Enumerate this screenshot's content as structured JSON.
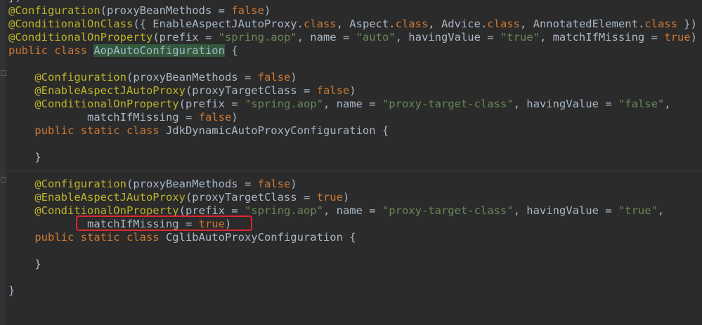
{
  "editor": {
    "language": "java",
    "colors": {
      "background": "#2b2b2b",
      "annotation": "#bbb529",
      "keyword": "#cc7832",
      "string": "#6a8759",
      "plain": "#a9b7c6",
      "identifier_highlight": "#32593d",
      "callout_box": "#e0262f"
    },
    "lines": [
      {
        "t": [
          [
            "pn",
            "})"
          ]
        ]
      },
      {
        "t": [
          [
            "ann",
            "@Configuration"
          ],
          [
            "pn",
            "(proxyBeanMethods = "
          ],
          [
            "kw",
            "false"
          ],
          [
            "pn",
            ")"
          ]
        ]
      },
      {
        "t": [
          [
            "ann",
            "@ConditionalOnClass"
          ],
          [
            "pn",
            "({ EnableAspectJAutoProxy."
          ],
          [
            "kw",
            "class"
          ],
          [
            "pn",
            ", Aspect."
          ],
          [
            "kw",
            "class"
          ],
          [
            "pn",
            ", Advice."
          ],
          [
            "kw",
            "class"
          ],
          [
            "pn",
            ", AnnotatedElement."
          ],
          [
            "kw",
            "class"
          ],
          [
            "pn",
            " })"
          ]
        ]
      },
      {
        "t": [
          [
            "ann",
            "@ConditionalOnProperty"
          ],
          [
            "pn",
            "(prefix = "
          ],
          [
            "str",
            "\"spring.aop\""
          ],
          [
            "pn",
            ", name = "
          ],
          [
            "str",
            "\"auto\""
          ],
          [
            "pn",
            ", havingValue = "
          ],
          [
            "str",
            "\"true\""
          ],
          [
            "pn",
            ", matchIfMissing = "
          ],
          [
            "kw",
            "true"
          ],
          [
            "pn",
            ")"
          ]
        ]
      },
      {
        "t": [
          [
            "kw",
            "public class "
          ],
          [
            "hl",
            "AopAutoConfiguration"
          ],
          [
            "pn",
            " {"
          ]
        ]
      },
      {
        "t": []
      },
      {
        "t": [
          [
            "pn",
            "    "
          ],
          [
            "ann",
            "@Configuration"
          ],
          [
            "pn",
            "(proxyBeanMethods = "
          ],
          [
            "kw",
            "false"
          ],
          [
            "pn",
            ")"
          ]
        ]
      },
      {
        "t": [
          [
            "pn",
            "    "
          ],
          [
            "ann",
            "@EnableAspectJAutoProxy"
          ],
          [
            "pn",
            "(proxyTargetClass = "
          ],
          [
            "kw",
            "false"
          ],
          [
            "pn",
            ")"
          ]
        ]
      },
      {
        "t": [
          [
            "pn",
            "    "
          ],
          [
            "ann",
            "@ConditionalOnProperty"
          ],
          [
            "pn",
            "(prefix = "
          ],
          [
            "str",
            "\"spring.aop\""
          ],
          [
            "pn",
            ", name = "
          ],
          [
            "str",
            "\"proxy-target-class\""
          ],
          [
            "pn",
            ", havingValue = "
          ],
          [
            "str",
            "\"false\""
          ],
          [
            "pn",
            ","
          ]
        ]
      },
      {
        "t": [
          [
            "pn",
            "            matchIfMissing = "
          ],
          [
            "kw",
            "false"
          ],
          [
            "pn",
            ")"
          ]
        ]
      },
      {
        "t": [
          [
            "pn",
            "    "
          ],
          [
            "kw",
            "public static class "
          ],
          [
            "pn",
            "JdkDynamicAutoProxyConfiguration {"
          ]
        ]
      },
      {
        "t": []
      },
      {
        "t": [
          [
            "pn",
            "    }"
          ]
        ]
      },
      {
        "t": []
      },
      {
        "t": [
          [
            "pn",
            "    "
          ],
          [
            "ann",
            "@Configuration"
          ],
          [
            "pn",
            "(proxyBeanMethods = "
          ],
          [
            "kw",
            "false"
          ],
          [
            "pn",
            ")"
          ]
        ]
      },
      {
        "t": [
          [
            "pn",
            "    "
          ],
          [
            "ann",
            "@EnableAspectJAutoProxy"
          ],
          [
            "pn",
            "(proxyTargetClass = "
          ],
          [
            "kw",
            "true"
          ],
          [
            "pn",
            ")"
          ]
        ]
      },
      {
        "t": [
          [
            "pn",
            "    "
          ],
          [
            "ann",
            "@ConditionalOnProperty"
          ],
          [
            "pn",
            "(prefix = "
          ],
          [
            "str",
            "\"spring.aop\""
          ],
          [
            "pn",
            ", name = "
          ],
          [
            "str",
            "\"proxy-target-class\""
          ],
          [
            "pn",
            ", havingValue = "
          ],
          [
            "str",
            "\"true\""
          ],
          [
            "pn",
            ","
          ]
        ]
      },
      {
        "t": [
          [
            "pn",
            "            matchIfMissing = "
          ],
          [
            "kw",
            "true"
          ],
          [
            "pn",
            ")"
          ]
        ]
      },
      {
        "t": [
          [
            "pn",
            "    "
          ],
          [
            "kw",
            "public static class "
          ],
          [
            "pn",
            "CglibAutoProxyConfiguration {"
          ]
        ]
      },
      {
        "t": []
      },
      {
        "t": [
          [
            "pn",
            "    }"
          ]
        ]
      },
      {
        "t": []
      },
      {
        "t": [
          [
            "pn",
            "}"
          ]
        ]
      }
    ],
    "highlighted_text": "matchIfMissing = true)"
  }
}
